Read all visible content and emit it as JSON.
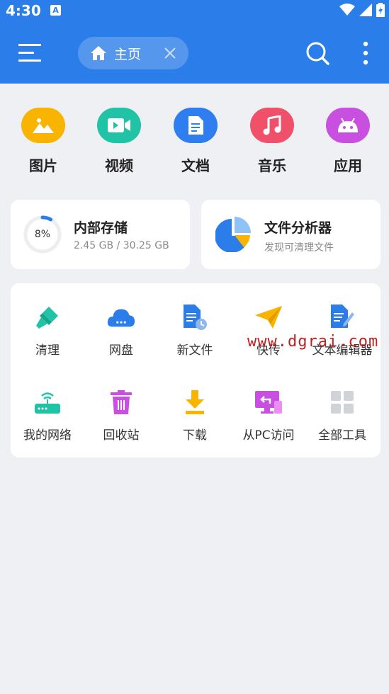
{
  "status": {
    "time": "4:30",
    "notif": "A"
  },
  "header": {
    "path_label": "主页"
  },
  "categories": [
    {
      "label": "图片",
      "color": "#f8b400",
      "icon": "image-icon"
    },
    {
      "label": "视频",
      "color": "#20c3a6",
      "icon": "video-icon"
    },
    {
      "label": "文档",
      "color": "#2e7ef0",
      "icon": "document-icon"
    },
    {
      "label": "音乐",
      "color": "#f0506a",
      "icon": "music-icon"
    },
    {
      "label": "应用",
      "color": "#c94fe0",
      "icon": "android-icon"
    }
  ],
  "storage": {
    "title": "内部存储",
    "usage": "2.45 GB / 30.25 GB",
    "percent_label": "8%",
    "fraction": 0.08
  },
  "analyzer": {
    "title": "文件分析器",
    "subtitle": "发现可清理文件"
  },
  "tools": [
    {
      "label": "清理",
      "icon": "broom-icon"
    },
    {
      "label": "网盘",
      "icon": "cloud-icon"
    },
    {
      "label": "新文件",
      "icon": "new-file-icon"
    },
    {
      "label": "快传",
      "icon": "send-icon"
    },
    {
      "label": "文本编辑器",
      "icon": "text-editor-icon"
    },
    {
      "label": "我的网络",
      "icon": "router-icon"
    },
    {
      "label": "回收站",
      "icon": "trash-icon"
    },
    {
      "label": "下载",
      "icon": "download-icon"
    },
    {
      "label": "从PC访问",
      "icon": "pc-access-icon"
    },
    {
      "label": "全部工具",
      "icon": "all-tools-icon"
    }
  ],
  "watermark": "www.dgrai.com"
}
